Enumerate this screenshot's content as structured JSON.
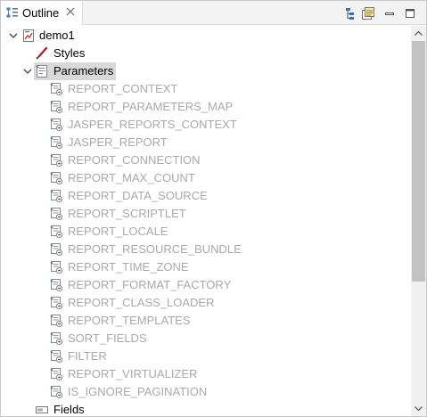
{
  "view": {
    "tab_label": "Outline",
    "tab_icon": "outline-view-icon",
    "toolbar": {
      "collapse_icon": "hierarchy-icon",
      "sort_icon": "link-editor-icon",
      "minimize_icon": "minimize-icon",
      "maximize_icon": "maximize-icon"
    }
  },
  "tree": {
    "root": {
      "label": "demo1",
      "icon": "report-icon",
      "expanded": true
    },
    "styles": {
      "label": "Styles",
      "icon": "styles-brush-icon"
    },
    "parameters": {
      "label": "Parameters",
      "icon": "parameters-icon",
      "expanded": true,
      "selected": true
    },
    "parameter_items": [
      "REPORT_CONTEXT",
      "REPORT_PARAMETERS_MAP",
      "JASPER_REPORTS_CONTEXT",
      "JASPER_REPORT",
      "REPORT_CONNECTION",
      "REPORT_MAX_COUNT",
      "REPORT_DATA_SOURCE",
      "REPORT_SCRIPTLET",
      "REPORT_LOCALE",
      "REPORT_RESOURCE_BUNDLE",
      "REPORT_TIME_ZONE",
      "REPORT_FORMAT_FACTORY",
      "REPORT_CLASS_LOADER",
      "REPORT_TEMPLATES",
      "SORT_FIELDS",
      "FILTER",
      "REPORT_VIRTUALIZER",
      "IS_IGNORE_PAGINATION"
    ],
    "fields": {
      "label": "Fields",
      "icon": "fields-icon"
    }
  },
  "colors": {
    "system_parameter_text": "#a9a9a9",
    "selection_bg": "#d9d9d9"
  }
}
